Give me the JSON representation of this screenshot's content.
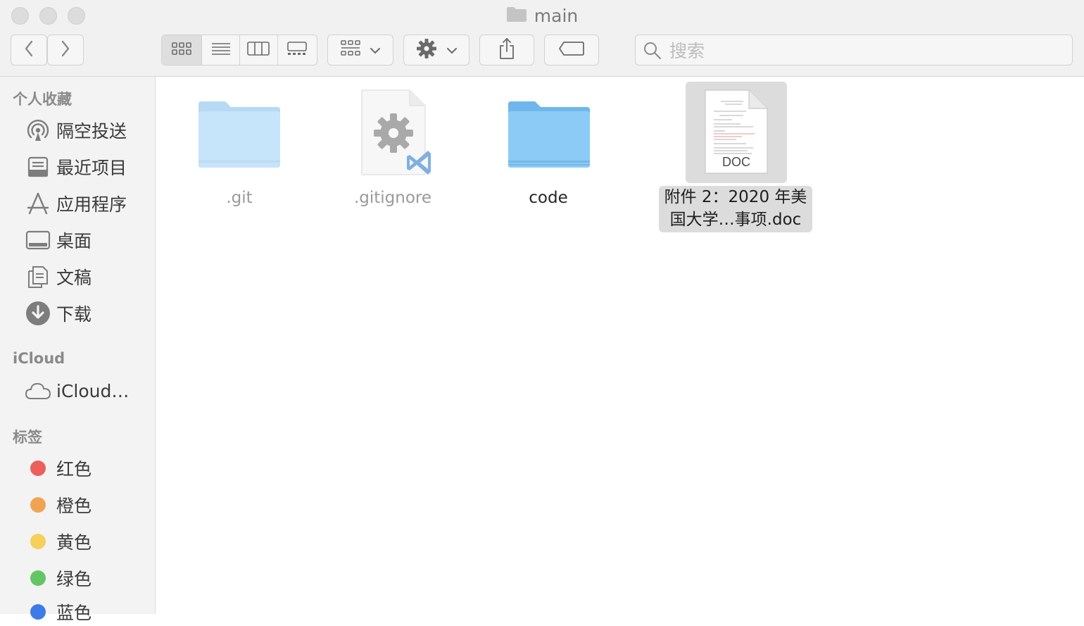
{
  "window": {
    "title": "main"
  },
  "toolbar": {
    "back_label": "‹",
    "forward_label": "›",
    "search_placeholder": "搜索"
  },
  "sidebar": {
    "favorites_title": "个人收藏",
    "favorites": [
      {
        "label": "隔空投送",
        "icon": "airdrop-icon"
      },
      {
        "label": "最近项目",
        "icon": "recents-icon"
      },
      {
        "label": "应用程序",
        "icon": "applications-icon"
      },
      {
        "label": "桌面",
        "icon": "desktop-icon"
      },
      {
        "label": "文稿",
        "icon": "documents-icon"
      },
      {
        "label": "下载",
        "icon": "downloads-icon"
      }
    ],
    "icloud_title": "iCloud",
    "icloud": [
      {
        "label": "iCloud…",
        "icon": "cloud-icon"
      }
    ],
    "tags_title": "标签",
    "tags": [
      {
        "label": "红色",
        "color": "#ec5f5b"
      },
      {
        "label": "橙色",
        "color": "#f0a453"
      },
      {
        "label": "黄色",
        "color": "#f5d05a"
      },
      {
        "label": "绿色",
        "color": "#62c665"
      },
      {
        "label": "蓝色",
        "color": "#3d7be8"
      }
    ]
  },
  "files": [
    {
      "name": ".git",
      "kind": "folder",
      "hidden": true
    },
    {
      "name": ".gitignore",
      "kind": "vscode-settings-file",
      "hidden": true
    },
    {
      "name": "code",
      "kind": "folder",
      "hidden": false
    },
    {
      "name_line1": "附件 2：2020 年美",
      "name_line2": "国大学…事项.doc",
      "kind": "doc",
      "badge": "DOC",
      "selected": true
    }
  ]
}
